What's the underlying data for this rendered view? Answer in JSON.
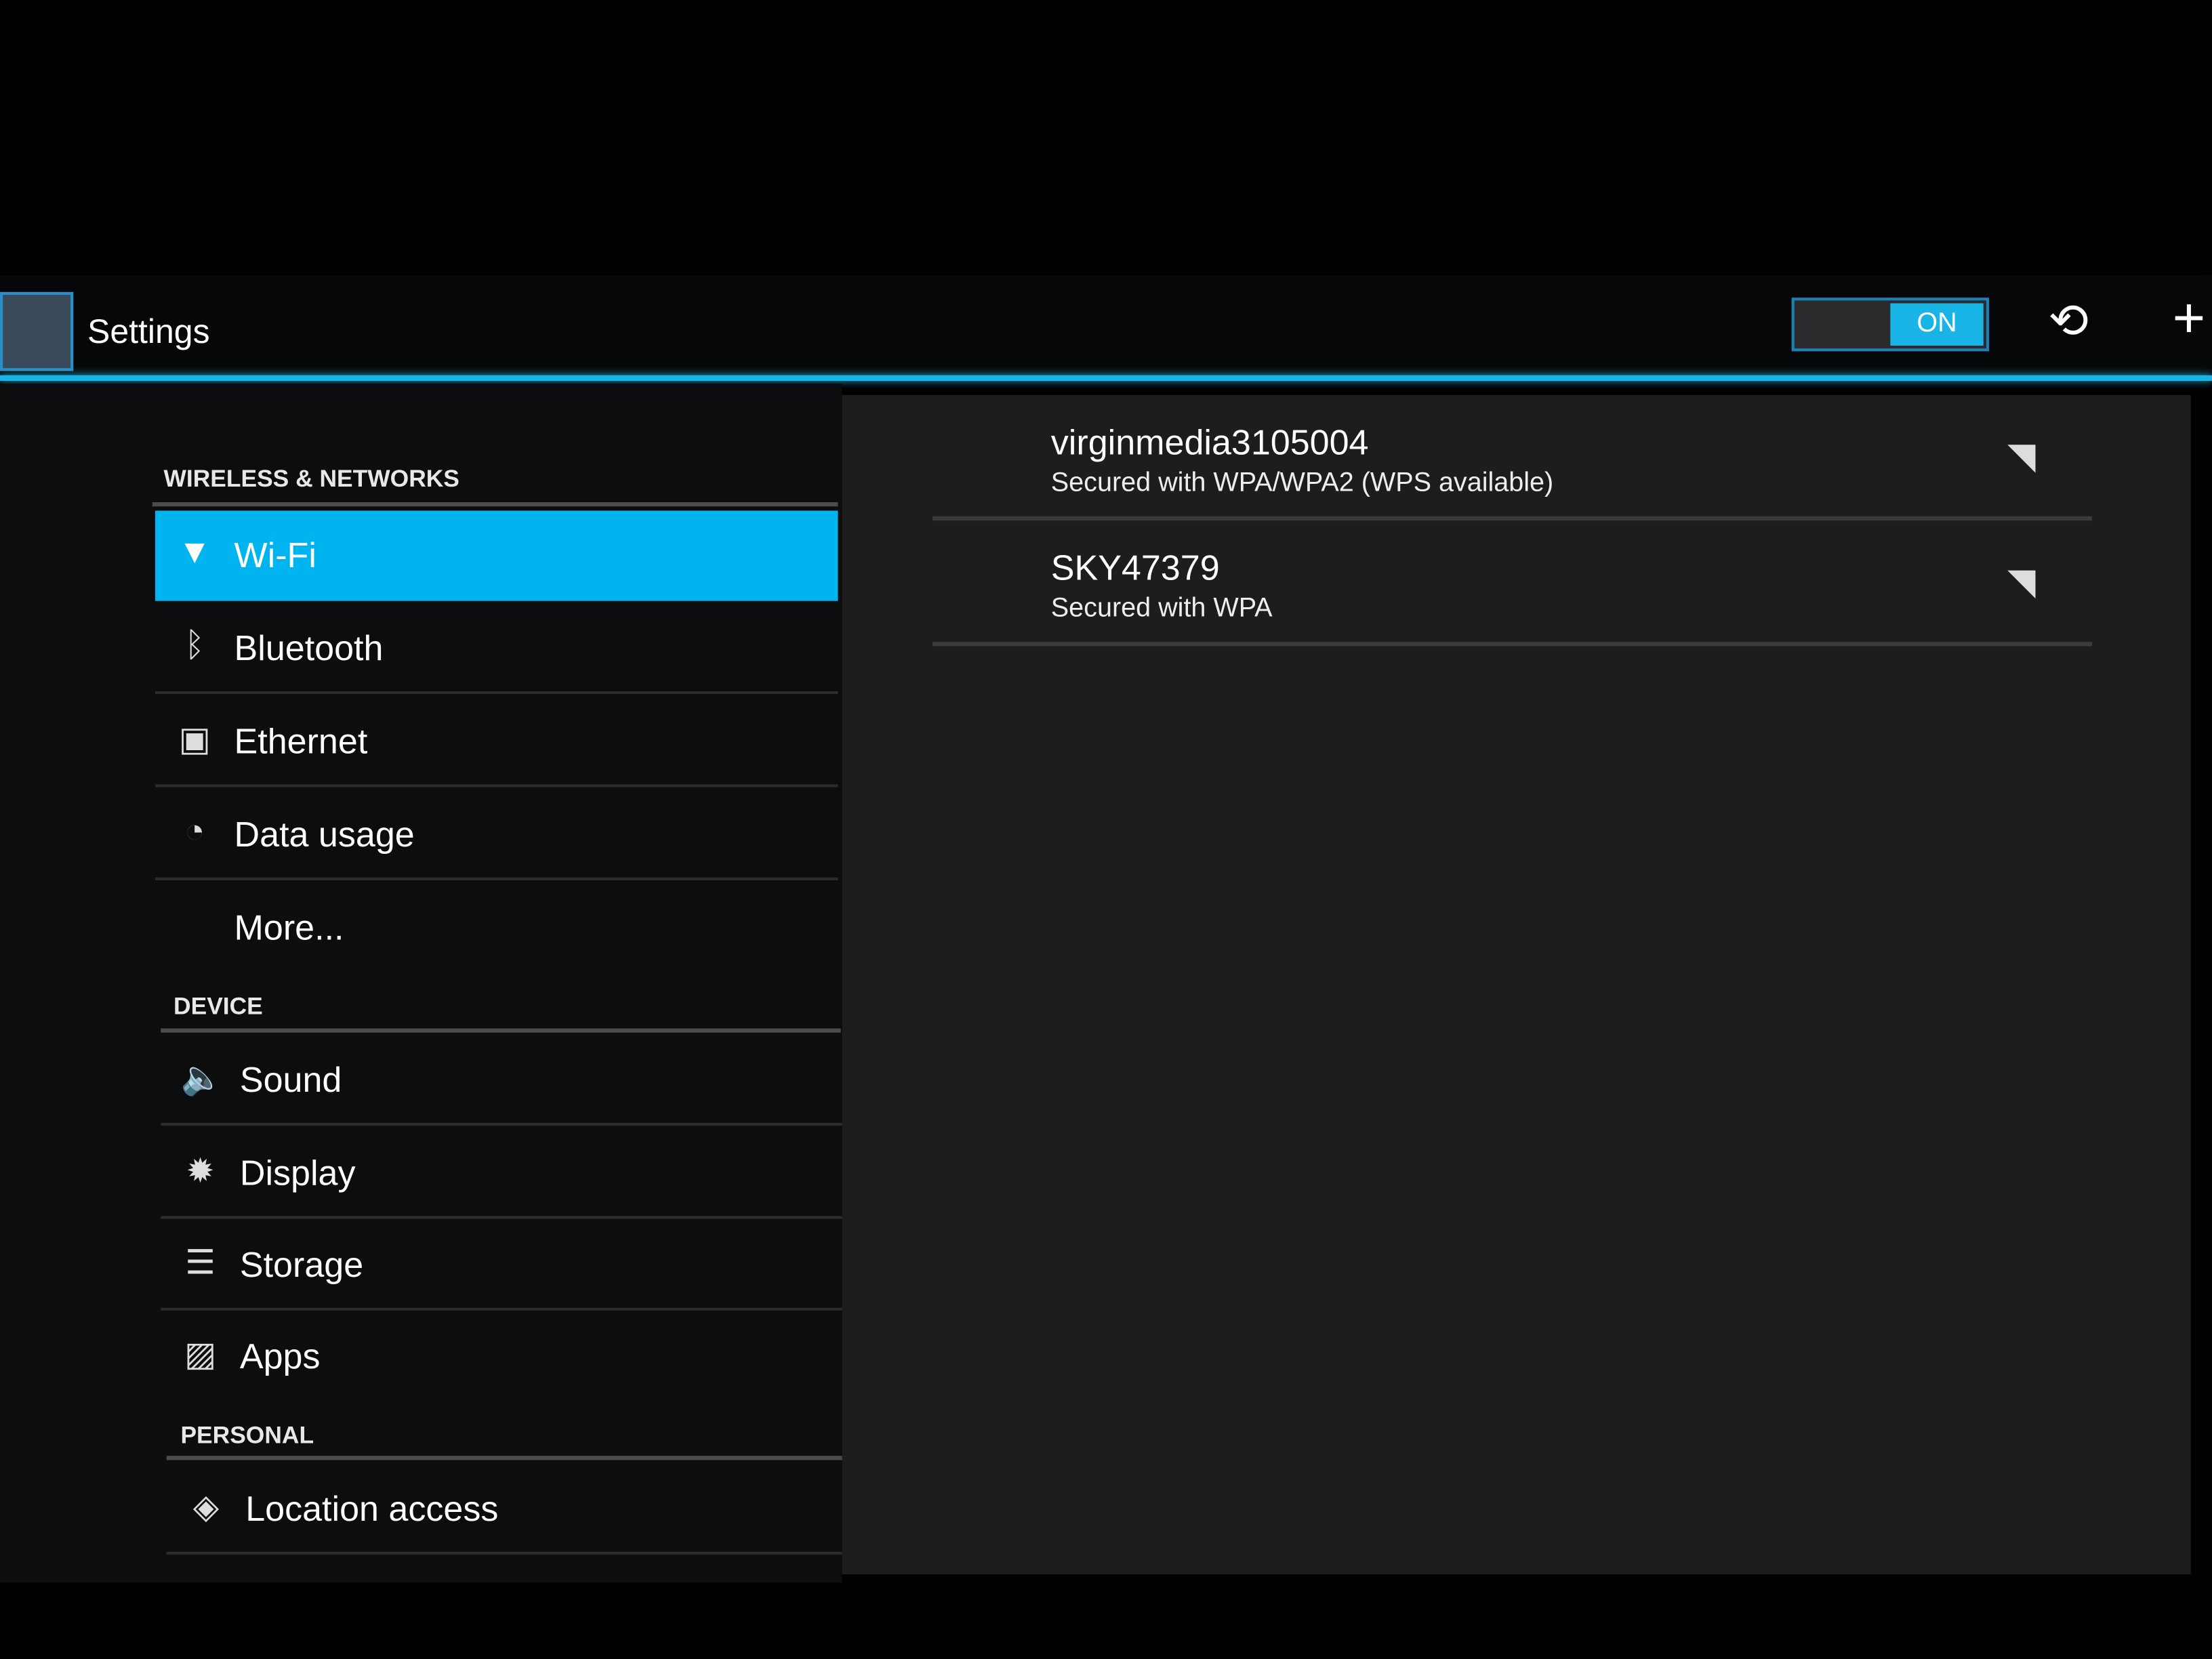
{
  "action_bar": {
    "title": "Settings",
    "wifi_toggle": "ON",
    "accent_color": "#19b4e6"
  },
  "sidebar": {
    "sections": [
      {
        "header": "WIRELESS & NETWORKS",
        "items": [
          {
            "label": "Wi-Fi",
            "icon": "wifi-icon",
            "selected": true
          },
          {
            "label": "Bluetooth",
            "icon": "bluetooth-icon"
          },
          {
            "label": "Ethernet",
            "icon": "ethernet-icon"
          },
          {
            "label": "Data usage",
            "icon": "data-usage-icon"
          },
          {
            "label": "More...",
            "icon": ""
          }
        ]
      },
      {
        "header": "DEVICE",
        "items": [
          {
            "label": "Sound",
            "icon": "speaker-icon"
          },
          {
            "label": "Display",
            "icon": "brightness-icon"
          },
          {
            "label": "Storage",
            "icon": "storage-icon"
          },
          {
            "label": "Apps",
            "icon": "apps-icon"
          }
        ]
      },
      {
        "header": "PERSONAL",
        "items": [
          {
            "label": "Location access",
            "icon": "location-icon"
          }
        ]
      }
    ]
  },
  "networks": [
    {
      "name": "virginmedia3105004",
      "status": "Secured with WPA/WPA2 (WPS available)",
      "icon": "wifi-lock-icon"
    },
    {
      "name": "SKY47379",
      "status": "Secured with WPA",
      "icon": "wifi-lock-icon"
    }
  ]
}
